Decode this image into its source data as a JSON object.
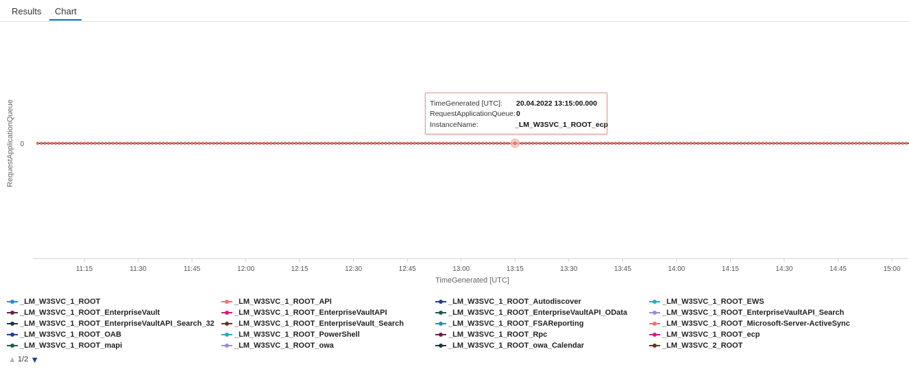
{
  "tabs": [
    {
      "label": "Results",
      "active": false
    },
    {
      "label": "Chart",
      "active": true
    }
  ],
  "colors": {
    "accent": "#0f6cbd",
    "highlight_series": "#e8776a"
  },
  "chart_data": {
    "type": "line",
    "ylabel": "RequestApplicationQueue",
    "xlabel": "TimeGenerated [UTC]",
    "y_ticks": [
      "0"
    ],
    "x_ticks": [
      "11:15",
      "11:30",
      "11:45",
      "12:00",
      "12:15",
      "12:30",
      "12:45",
      "13:00",
      "13:15",
      "13:30",
      "13:45",
      "14:00",
      "14:15",
      "14:30",
      "14:45",
      "15:00"
    ],
    "x_range": [
      "11:02",
      "15:05"
    ],
    "sample_interval_minutes": 1,
    "all_series_value": 0,
    "series": [
      {
        "name": "_LM_W3SVC_1_ROOT",
        "color": "#2b88d8"
      },
      {
        "name": "_LM_W3SVC_1_ROOT_API",
        "color": "#e8776a"
      },
      {
        "name": "_LM_W3SVC_1_ROOT_Autodiscover",
        "color": "#1f3d8f"
      },
      {
        "name": "_LM_W3SVC_1_ROOT_EWS",
        "color": "#29a8c7"
      },
      {
        "name": "_LM_W3SVC_1_ROOT_EnterpriseVault",
        "color": "#6b1e4a"
      },
      {
        "name": "_LM_W3SVC_1_ROOT_EnterpriseVaultAPI",
        "color": "#d9197c"
      },
      {
        "name": "_LM_W3SVC_1_ROOT_EnterpriseVaultAPI_OData",
        "color": "#1e5b4b"
      },
      {
        "name": "_LM_W3SVC_1_ROOT_EnterpriseVaultAPI_Search",
        "color": "#9a8be0"
      },
      {
        "name": "_LM_W3SVC_1_ROOT_EnterpriseVaultAPI_Search_32",
        "color": "#1d3540"
      },
      {
        "name": "_LM_W3SVC_1_ROOT_EnterpriseVault_Search",
        "color": "#5a3a1e"
      },
      {
        "name": "_LM_W3SVC_1_ROOT_FSAReporting",
        "color": "#2b88d8"
      },
      {
        "name": "_LM_W3SVC_1_ROOT_Microsoft-Server-ActiveSync",
        "color": "#e8776a"
      },
      {
        "name": "_LM_W3SVC_1_ROOT_OAB",
        "color": "#1f3d8f"
      },
      {
        "name": "_LM_W3SVC_1_ROOT_PowerShell",
        "color": "#29a8c7"
      },
      {
        "name": "_LM_W3SVC_1_ROOT_Rpc",
        "color": "#6b1e4a"
      },
      {
        "name": "_LM_W3SVC_1_ROOT_ecp",
        "color": "#d9197c"
      },
      {
        "name": "_LM_W3SVC_1_ROOT_mapi",
        "color": "#1e5b4b"
      },
      {
        "name": "_LM_W3SVC_1_ROOT_owa",
        "color": "#9a8be0"
      },
      {
        "name": "_LM_W3SVC_1_ROOT_owa_Calendar",
        "color": "#1d3540"
      },
      {
        "name": "_LM_W3SVC_2_ROOT",
        "color": "#5a3a1e"
      }
    ],
    "legend_position": "bottom",
    "grid": false,
    "tooltip": {
      "rows": [
        {
          "key": "TimeGenerated [UTC]:",
          "value": "20.04.2022 13:15:00.000"
        },
        {
          "key": "RequestApplicationQueue:",
          "value": "0"
        },
        {
          "key": "InstanceName:",
          "value": "_LM_W3SVC_1_ROOT_ecp"
        }
      ],
      "hover_x": "13:15"
    }
  },
  "pager": {
    "label": "1/2",
    "up_icon": "triangle-up-icon",
    "down_icon": "triangle-down-icon"
  }
}
